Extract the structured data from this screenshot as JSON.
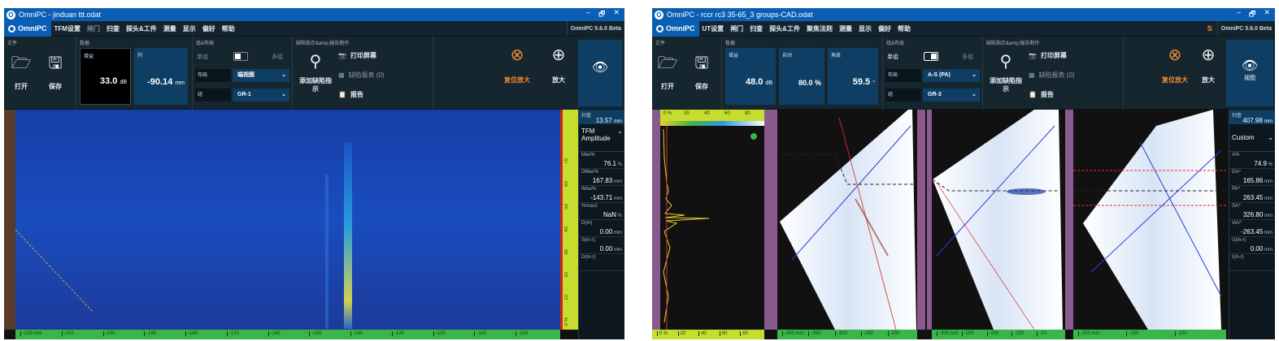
{
  "left": {
    "title": "OmniPC - jinduan ttt.odat",
    "brand": "OmniPC",
    "menu": [
      {
        "label": "TFM设置",
        "dim": false
      },
      {
        "label": "闸门",
        "dim": true
      },
      {
        "label": "扫查",
        "dim": false
      },
      {
        "label": "探头&工件",
        "dim": false
      },
      {
        "label": "测量",
        "dim": false
      },
      {
        "label": "显示",
        "dim": false
      },
      {
        "label": "偏好",
        "dim": false
      },
      {
        "label": "帮助",
        "dim": false
      }
    ],
    "version": "OmniPC 5.6.0 Beta",
    "file_group": "文件",
    "open": "打开",
    "save": "保存",
    "data_group": "数据",
    "gain_label": "增益",
    "gain_value": "33.0",
    "gain_unit": "dB",
    "col_label": "列",
    "col_value": "-90.14",
    "col_unit": "mm",
    "layout_group": "组&布局",
    "single": "单组",
    "multi": "多组",
    "layout_label": "布局",
    "layout_value": "端视图",
    "group_label": "组",
    "group_value": "GR-1",
    "defect_group": "缺陷指示&amp;报告制作",
    "add_defect": "添加缺陷指示",
    "print": "打印屏幕",
    "defect_table": "缺陷报表 (0)",
    "report": "报告",
    "reset_zoom": "复位放大",
    "zoom": "放大",
    "scan_label": "扫查",
    "scan_value": "13.57",
    "scan_unit": "mm",
    "mode": "TFM Amplitude",
    "readings": [
      {
        "l": "Max%",
        "v": "76.1",
        "u": "%"
      },
      {
        "l": "DMax%",
        "v": "167.83",
        "u": "mm"
      },
      {
        "l": "IMax%",
        "v": "-143.71",
        "u": "mm"
      },
      {
        "l": "%max2",
        "v": "NaN",
        "u": "%"
      },
      {
        "l": "D(m)",
        "v": "0.00",
        "u": "mm"
      },
      {
        "l": "S(m-r)",
        "v": "0.00",
        "u": "mm"
      },
      {
        "l": "D(m-r)",
        "v": "",
        "u": ""
      }
    ],
    "axis_ticks": [
      "-220 mm",
      "-210",
      "-200",
      "-190",
      "-180",
      "-170",
      "-160",
      "-150",
      "-140",
      "-130",
      "-120",
      "-110",
      "-100"
    ],
    "vscale": [
      "70",
      "60",
      "50",
      "40",
      "30",
      "20",
      "10",
      "0 %"
    ],
    "left_ticks": [
      "130",
      "120",
      "110",
      "100"
    ]
  },
  "right": {
    "title": "OmniPC - rccr rc3 35-65_3 groups-CAD.odat",
    "brand": "OmniPC",
    "menu": [
      {
        "label": "UT设置",
        "dim": false
      },
      {
        "label": "闸门",
        "dim": false
      },
      {
        "label": "扫查",
        "dim": false
      },
      {
        "label": "探头&工件",
        "dim": false
      },
      {
        "label": "聚焦法则",
        "dim": false
      },
      {
        "label": "测量",
        "dim": false
      },
      {
        "label": "显示",
        "dim": false
      },
      {
        "label": "偏好",
        "dim": false
      },
      {
        "label": "帮助",
        "dim": false
      }
    ],
    "warn": "S",
    "version": "OmniPC 5.6.0 Beta",
    "file_group": "文件",
    "open": "打开",
    "save": "保存",
    "data_group": "数据",
    "gain_label": "增益",
    "gain_value": "48.0",
    "gain_unit": "dB",
    "auto_label": "自动",
    "auto_value": "80.0 %",
    "angle_label": "角度",
    "angle_value": "59.5",
    "angle_unit": "°",
    "layout_group": "组&布局",
    "single": "单组",
    "multi": "多组",
    "layout_label": "布局",
    "layout_value": "A-S (PA)",
    "group_label": "组",
    "group_value": "GR-3",
    "defect_group": "缺陷指示&amp;报告制作",
    "add_defect": "添加缺陷指示",
    "print": "打印屏幕",
    "defect_table": "缺陷报表 (0)",
    "report": "报告",
    "reset_zoom": "复位放大",
    "zoom": "放大",
    "view": "视图",
    "scan_label": "扫查",
    "scan_value": "407.98",
    "scan_unit": "mm",
    "mode": "Custom",
    "readings": [
      {
        "l": "A%",
        "v": "74.9",
        "u": "%"
      },
      {
        "l": "DA^",
        "v": "165.86",
        "u": "mm"
      },
      {
        "l": "PA^",
        "v": "263.45",
        "u": "mm"
      },
      {
        "l": "SA^",
        "v": "326.80",
        "u": "mm"
      },
      {
        "l": "ViA^",
        "v": "-263.45",
        "u": "mm"
      },
      {
        "l": "U(m-r)",
        "v": "0.00",
        "u": "mm"
      },
      {
        "l": "I(m-r)",
        "v": "",
        "u": ""
      }
    ],
    "ascan_top": [
      "0 %",
      "20",
      "40",
      "60",
      "80"
    ],
    "ascan_bot": [
      "0 %",
      "20",
      "40",
      "60",
      "80"
    ],
    "axis1": [
      "-400 mm",
      "-350",
      "-300",
      "-250",
      "-200"
    ],
    "axis2": [
      "-300 mm",
      "-250",
      "-200",
      "-150",
      "-10"
    ],
    "axis3": [
      "-200 mm",
      "-150",
      "-100"
    ]
  },
  "colors": {
    "brand": "#0a5fb4",
    "panel": "#0e3e63",
    "accent": "#f08c2d",
    "gate": "#e03030",
    "beam": "#2b3fd0"
  }
}
